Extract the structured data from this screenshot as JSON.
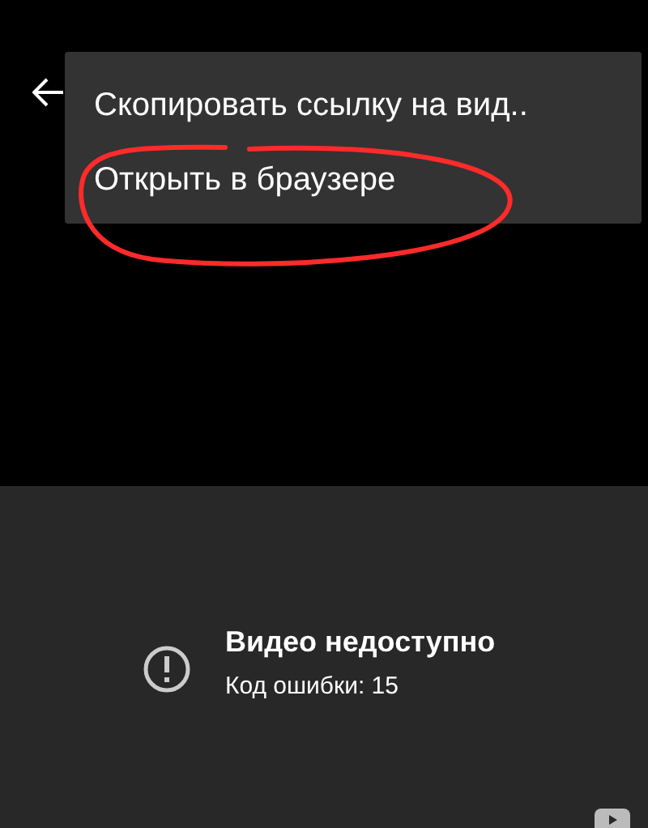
{
  "menu": {
    "items": [
      {
        "label": "Скопировать ссылку на вид.."
      },
      {
        "label": "Открыть в браузере",
        "annotated": true
      }
    ]
  },
  "error": {
    "title": "Видео недоступно",
    "code": "Код ошибки: 15"
  }
}
